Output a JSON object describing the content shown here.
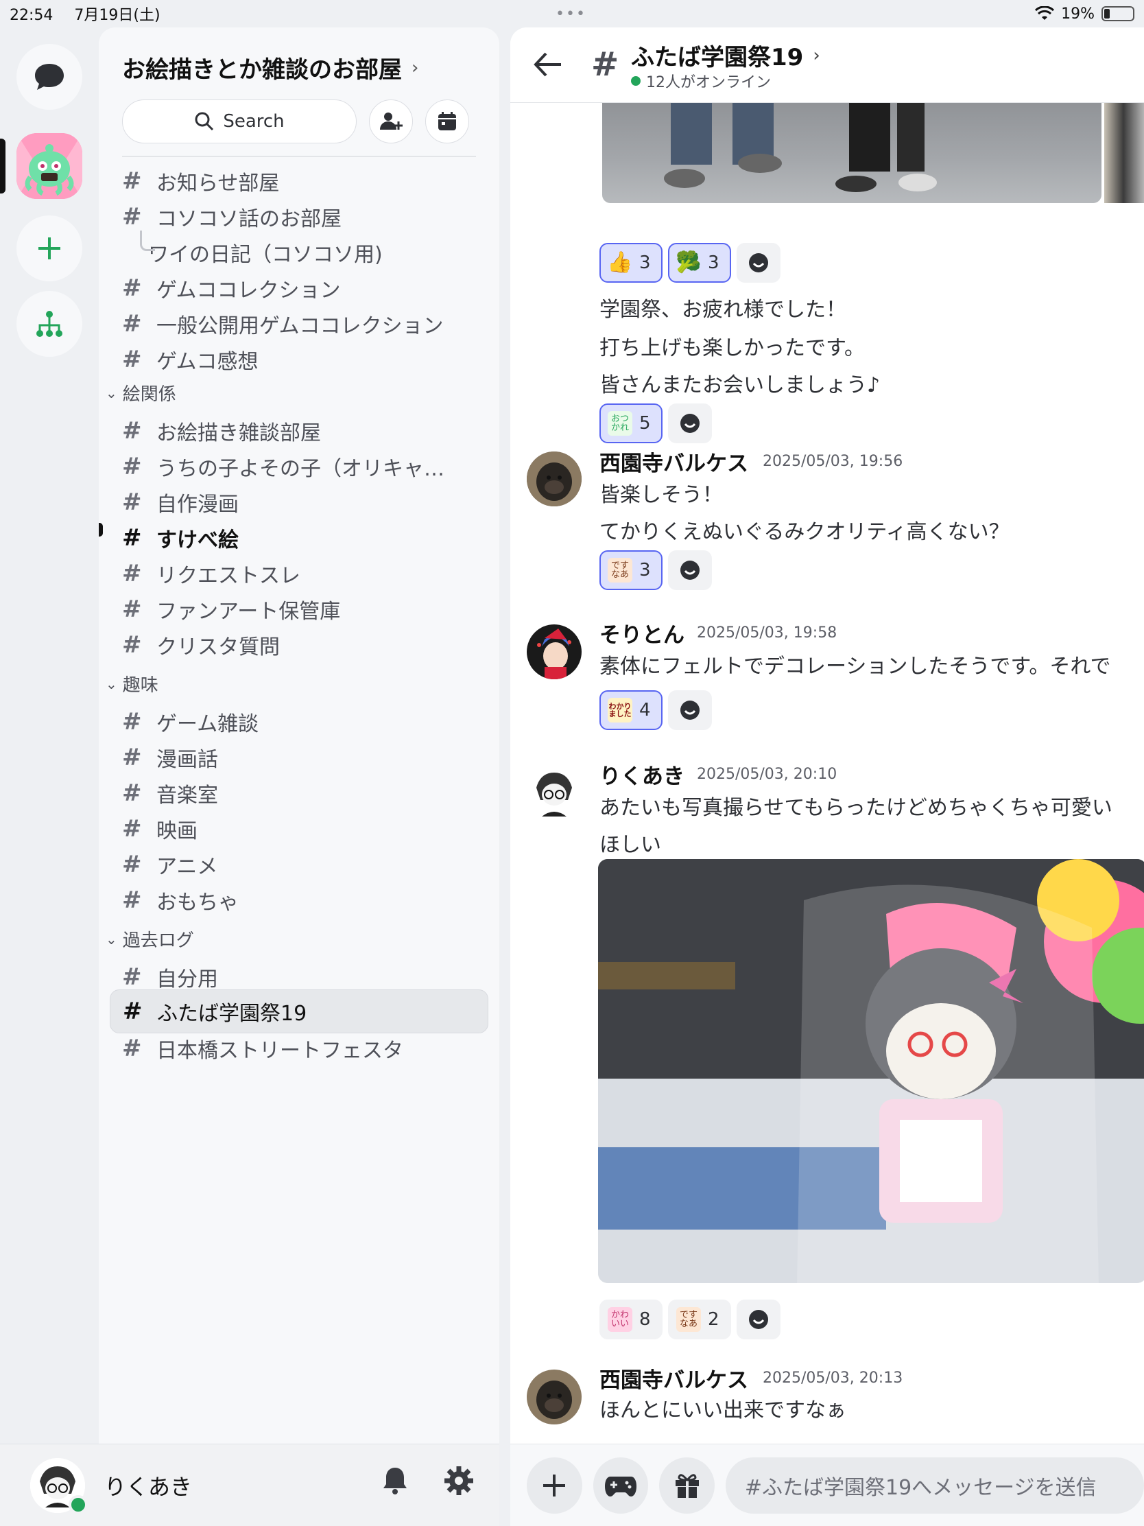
{
  "status": {
    "time": "22:54",
    "date": "7月19日(土)",
    "dots": "•••",
    "battery": "19%",
    "battery_level": 0.19
  },
  "server": {
    "name": "お絵描きとか雑談のお部屋"
  },
  "search": {
    "label": "Search"
  },
  "channels": [
    {
      "type": "channel",
      "name": "お知らせ部屋"
    },
    {
      "type": "channel",
      "name": "コソコソ話のお部屋"
    },
    {
      "type": "thread",
      "name": "ワイの日記（コソコソ用)"
    },
    {
      "type": "channel",
      "name": "ゲムココレクション"
    },
    {
      "type": "channel",
      "name": "一般公開用ゲムココレクション"
    },
    {
      "type": "channel",
      "name": "ゲムコ感想"
    }
  ],
  "categories": [
    {
      "name": "絵関係",
      "channels": [
        "お絵描き雑談部屋",
        "うちの子よその子（オリキャ…",
        "自作漫画",
        "すけべ絵",
        "リクエストスレ",
        "ファンアート保管庫",
        "クリスタ質問"
      ]
    },
    {
      "name": "趣味",
      "channels": [
        "ゲーム雑談",
        "漫画話",
        "音楽室",
        "映画",
        "アニメ",
        "おもちゃ"
      ]
    },
    {
      "name": "過去ログ",
      "channels": [
        "自分用",
        "ふたば学園祭19",
        "日本橋ストリートフェスタ"
      ]
    }
  ],
  "user": {
    "name": "りくあき"
  },
  "chat": {
    "title": "ふたば学園祭19",
    "online": "12人がオンライン",
    "composer_placeholder": "#ふたば学園祭19へメッセージを送信"
  },
  "messages": {
    "m0": {
      "reactions": [
        {
          "emoji": "👍",
          "count": "3"
        },
        {
          "emoji": "🥦",
          "count": "3"
        }
      ],
      "lines": [
        "学園祭、お疲れ様でした！",
        "打ち上げも楽しかったです。",
        "皆さんまたお会いしましょう♪"
      ],
      "reactions2": [
        {
          "emoji": "おつかれ",
          "count": "5"
        }
      ]
    },
    "m1": {
      "author": "西園寺バルケス",
      "time": "2025/05/03, 19:56",
      "lines": [
        "皆楽しそう！",
        "てかりくえぬいぐるみクオリティ高くない？"
      ],
      "reactions": [
        {
          "emoji": "ですなあ",
          "count": "3"
        }
      ]
    },
    "m2": {
      "author": "そりとん",
      "time": "2025/05/03, 19:58",
      "lines": [
        "素体にフェルトでデコレーションしたそうです。それで"
      ],
      "reactions": [
        {
          "emoji": "わかりました",
          "count": "4"
        }
      ]
    },
    "m3": {
      "author": "りくあき",
      "time": "2025/05/03, 20:10",
      "lines": [
        "あたいも写真撮らせてもらったけどめちゃくちゃ可愛い",
        "ほしい"
      ],
      "reactions": [
        {
          "emoji": "かわいい",
          "count": "8"
        },
        {
          "emoji": "ですなあ",
          "count": "2"
        }
      ]
    },
    "m4": {
      "author": "西園寺バルケス",
      "time": "2025/05/03, 20:13",
      "lines": [
        "ほんとにいい出来ですなぁ"
      ]
    }
  }
}
